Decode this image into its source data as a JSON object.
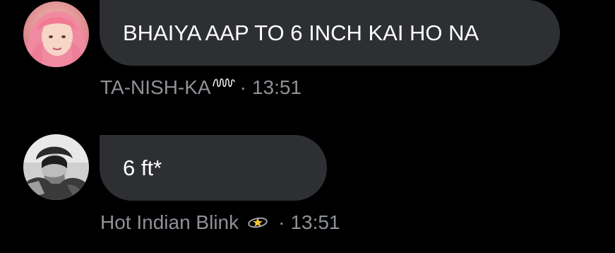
{
  "messages": [
    {
      "text": "BHAIYA AAP TO 6 INCH KAI HO NA",
      "sender": "TA-NISH-KA",
      "separator": "·",
      "time": "13:51",
      "name_decoration_icon": "squiggle-flourish-icon"
    },
    {
      "text": "6 ft*",
      "sender": "Hot Indian Blink",
      "separator": "·",
      "time": "13:51",
      "name_emoji_icon": "dizzy-star-ring-icon"
    }
  ],
  "colors": {
    "background": "#000000",
    "bubble": "#2d2f33",
    "message_text": "#ffffff",
    "meta_text": "#8e9196"
  }
}
